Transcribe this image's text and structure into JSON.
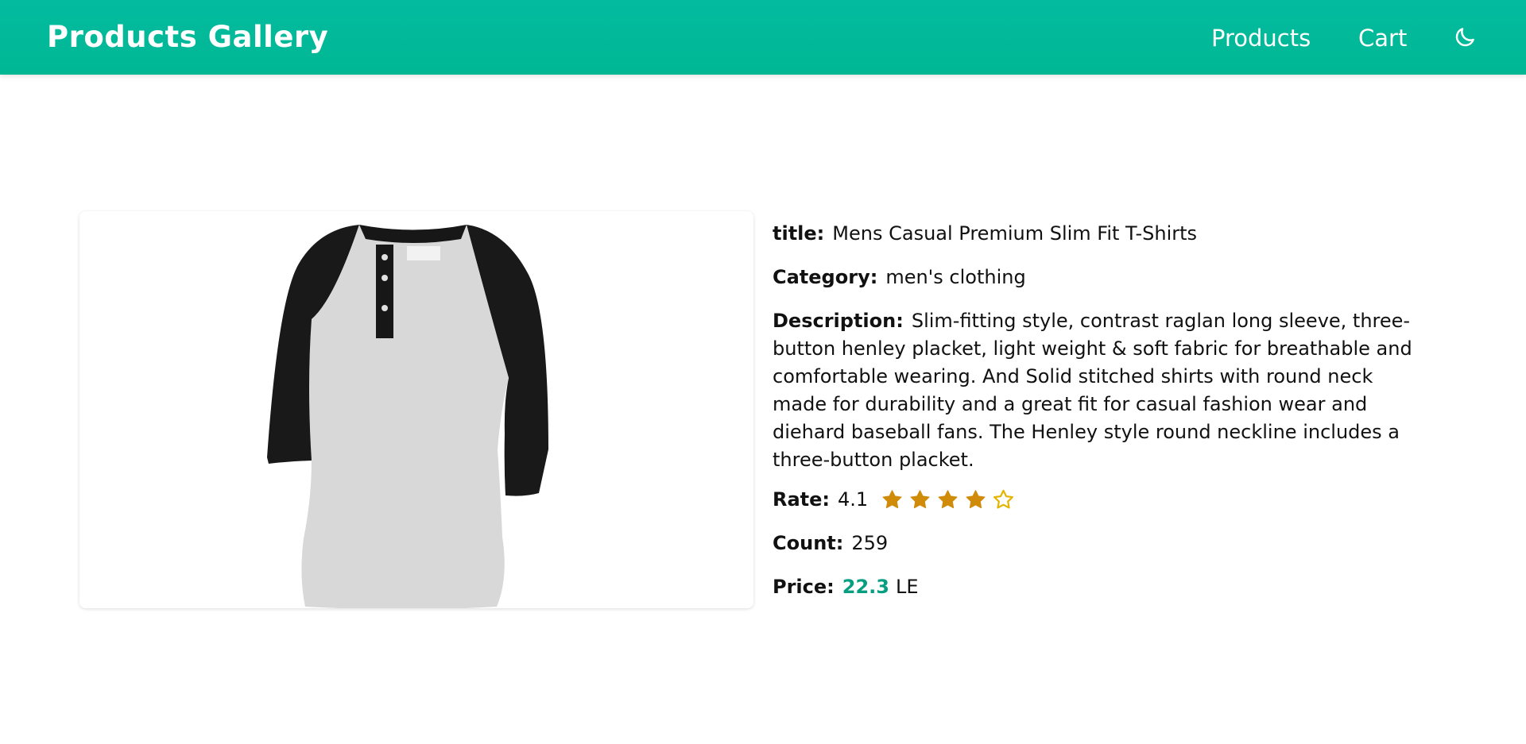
{
  "navbar": {
    "brand": "Products Gallery",
    "links": [
      "Products",
      "Cart"
    ],
    "theme_icon": "moon-icon"
  },
  "product": {
    "image_alt": "Mens Casual Premium Slim Fit T-Shirts",
    "labels": {
      "title": "title:",
      "category": "Category:",
      "description": "Description:",
      "rate": "Rate:",
      "count": "Count:",
      "price": "Price:"
    },
    "title": "Mens Casual Premium Slim Fit T-Shirts",
    "category": "men's clothing",
    "description": "Slim-fitting style, contrast raglan long sleeve, three-button henley placket, light weight & soft fabric for breathable and comfortable wearing. And Solid stitched shirts with round neck made for durability and a great fit for casual fashion wear and diehard baseball fans. The Henley style round neckline includes a three-button placket.",
    "rate": "4.1",
    "stars_filled": 4,
    "stars_total": 5,
    "count": "259",
    "price": "22.3",
    "currency": "LE"
  },
  "colors": {
    "navbar": "#00b794",
    "price": "#069e80",
    "star": "#d08b09"
  }
}
